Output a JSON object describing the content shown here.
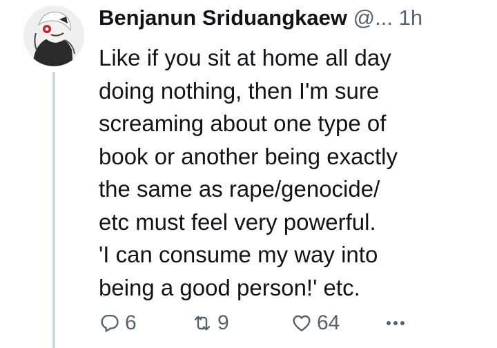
{
  "author": {
    "display_name": "Benjanun Sriduangkaew",
    "handle": "@...",
    "time": "1h"
  },
  "tweet": {
    "lines": [
      "Like if you sit at home all day",
      "doing nothing, then I'm sure",
      "screaming about one type of",
      "book or another being exactly",
      "the same as rape/genocide/",
      "etc must feel very powerful.",
      "'I can consume my way into",
      "being a good person!' etc."
    ]
  },
  "actions": {
    "reply_count": "6",
    "retweet_count": "9",
    "like_count": "64"
  },
  "icons": {
    "reply": "reply-icon",
    "retweet": "retweet-icon",
    "like": "heart-icon",
    "more": "more-icon"
  },
  "colors": {
    "text": "#0f1419",
    "secondary": "#536471",
    "thread_line": "#cfd9de"
  }
}
